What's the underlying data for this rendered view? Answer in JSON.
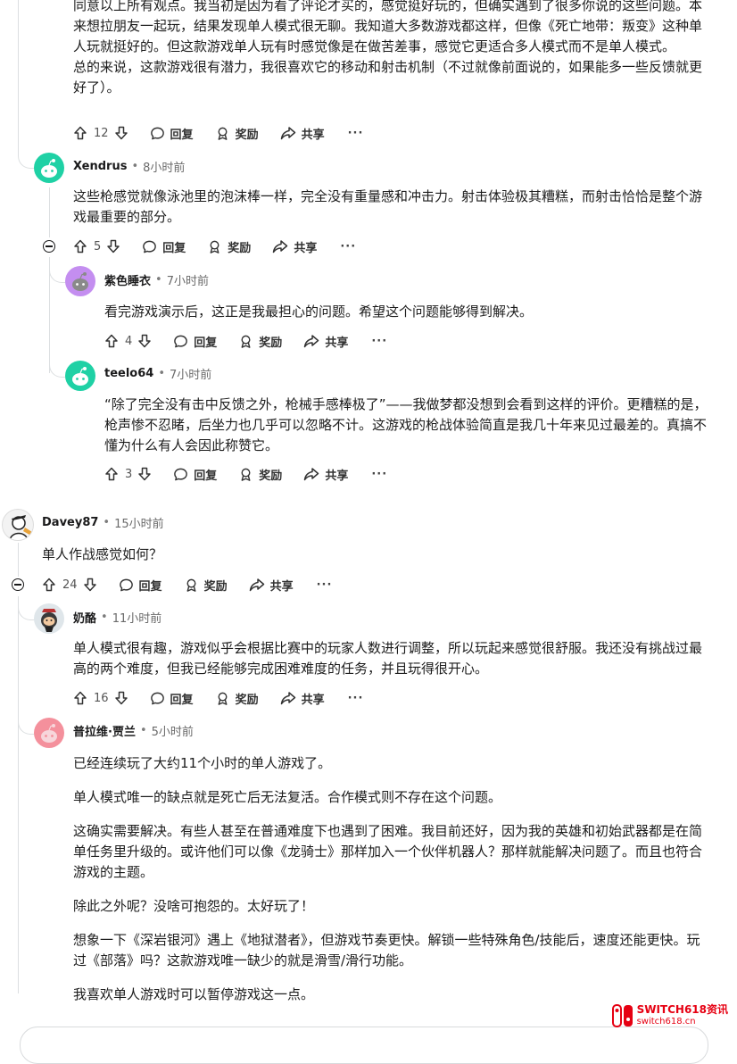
{
  "actions": {
    "reply": "回复",
    "award": "奖励",
    "share": "共享",
    "more": "···"
  },
  "comments": {
    "c0": {
      "paragraphs": [
        "同意以上所有观点。我当初是因为看了评论才买的，感觉挺好玩的，但确实遇到了很多你说的这些问题。本来想拉朋友一起玩，结果发现单人模式很无聊。我知道大多数游戏都这样，但像《死亡地带：叛变》这种单人玩就挺好的。但这款游戏单人玩有时感觉像是在做苦差事，感觉它更适合多人模式而不是单人模式。",
        "总的来说，这款游戏很有潜力，我很喜欢它的移动和射击机制（不过就像前面说的，如果能多一些反馈就更好了）。"
      ],
      "votes": "12"
    },
    "c1": {
      "user": "Xendrus",
      "time": "8小时前",
      "paragraphs": [
        "这些枪感觉就像泳池里的泡沫棒一样，完全没有重量感和冲击力。射击体验极其糟糕，而射击恰恰是整个游戏最重要的部分。"
      ],
      "votes": "5"
    },
    "c2": {
      "user": "紫色睡衣",
      "time": "7小时前",
      "paragraphs": [
        "看完游戏演示后，这正是我最担心的问题。希望这个问题能够得到解决。"
      ],
      "votes": "4"
    },
    "c3": {
      "user": "teelo64",
      "time": "7小时前",
      "paragraphs": [
        "“除了完全没有击中反馈之外，枪械手感棒极了”——我做梦都没想到会看到这样的评价。更糟糕的是，枪声惨不忍睹，后坐力也几乎可以忽略不计。这游戏的枪战体验简直是我几十年来见过最差的。真搞不懂为什么有人会因此称赞它。"
      ],
      "votes": "3"
    },
    "c4": {
      "user": "Davey87",
      "time": "15小时前",
      "paragraphs": [
        "单人作战感觉如何？"
      ],
      "votes": "24"
    },
    "c5": {
      "user": "奶酪",
      "time": "11小时前",
      "paragraphs": [
        "单人模式很有趣，游戏似乎会根据比赛中的玩家人数进行调整，所以玩起来感觉很舒服。我还没有挑战过最高的两个难度，但我已经能够完成困难难度的任务，并且玩得很开心。"
      ],
      "votes": "16"
    },
    "c6": {
      "user": "普拉维·贾兰",
      "time": "5小时前",
      "paragraphs": [
        "已经连续玩了大约11个小时的单人游戏了。",
        "单人模式唯一的缺点就是死亡后无法复活。合作模式则不存在这个问题。",
        "这确实需要解决。有些人甚至在普通难度下也遇到了困难。我目前还好，因为我的英雄和初始武器都是在简单任务里升级的。或许他们可以像《龙骑士》那样加入一个伙伴机器人？那样就能解决问题了。而且也符合游戏的主题。",
        "除此之外呢？没啥可抱怨的。太好玩了！",
        "想象一下《深岩银河》遇上《地狱潜者》，但游戏节奏更快。解锁一些特殊角色/技能后，速度还能更快。玩过《部落》吗？这款游戏唯一缺少的就是滑雪/滑行功能。",
        "我喜欢单人游戏时可以暂停游戏这一点。"
      ]
    }
  },
  "watermark": {
    "brand": "SWITCH618资讯",
    "site": "switch618.cn"
  },
  "colors": {
    "accent": "#e60012",
    "avatar_teal": "#1fd1a5",
    "avatar_purple": "#c48ef0",
    "avatar_pink": "#f4909c"
  }
}
